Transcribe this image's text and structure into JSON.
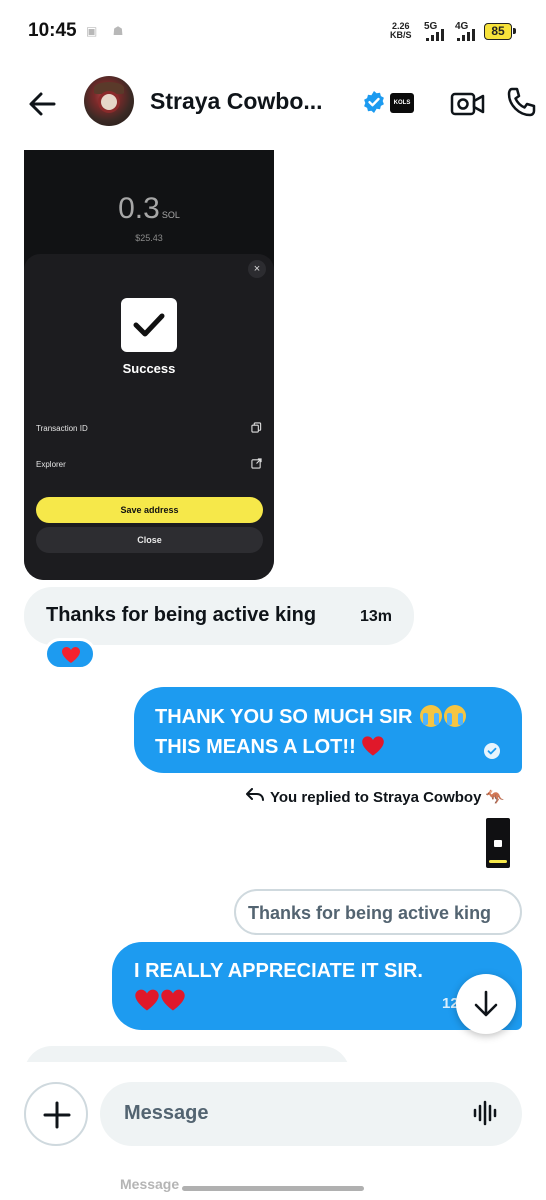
{
  "status_bar": {
    "time": "10:45",
    "net_speed_value": "2.26",
    "net_speed_unit": "KB/S",
    "net1": "5G",
    "net2": "4G",
    "battery": "85"
  },
  "header": {
    "contact_name": "Straya Cowbo...",
    "affiliate_badge": "KOLS"
  },
  "shared_screenshot": {
    "amount": "0.3",
    "unit": "SOL",
    "usd": "$25.43",
    "close_x": "×",
    "status": "Success",
    "row1": "Transaction ID",
    "row2": "Explorer",
    "save_button": "Save address",
    "close_button": "Close"
  },
  "messages": {
    "incoming_1": {
      "text": "Thanks for being active king",
      "time": "13m"
    },
    "outgoing_1": {
      "line1": "THANK YOU SO MUCH SIR",
      "line2": "THIS MEANS A LOT!!"
    },
    "reply_note": "You replied to Straya Cowboy",
    "quoted_text": "Thanks for being active king",
    "outgoing_2": {
      "line1": "I REALLY APPRECIATE IT SIR.",
      "time": "12"
    }
  },
  "composer": {
    "placeholder": "Message"
  },
  "ghost_hint": "Message",
  "colors": {
    "accent": "#1d9bf0",
    "incoming_bubble": "#eff3f4",
    "heart": "#f91880"
  }
}
